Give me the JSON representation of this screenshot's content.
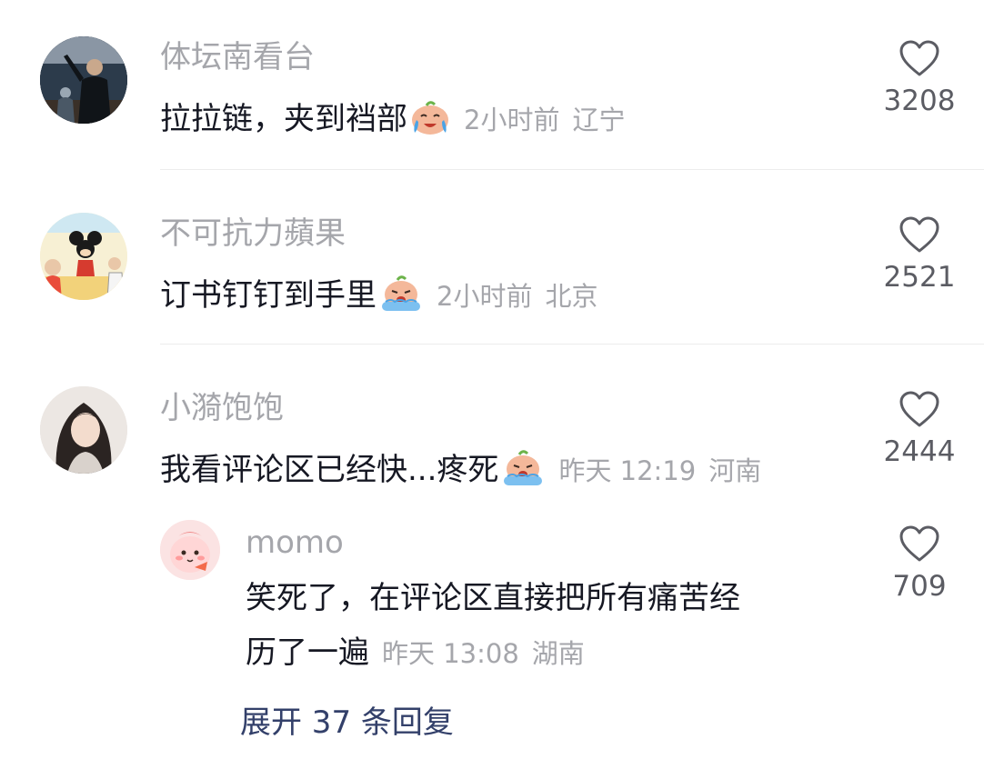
{
  "comments": [
    {
      "username": "体坛南看台",
      "text": "拉拉链，夹到裆部",
      "emoji": "crying-face-emoji",
      "time": "2小时前",
      "location": "辽宁",
      "likes": "3208",
      "avatar": "sports-photo-avatar"
    },
    {
      "username": "不可抗力蘋果",
      "text": "订书钉钉到手里",
      "emoji": "sobbing-face-emoji",
      "time": "2小时前",
      "location": "北京",
      "likes": "2521",
      "avatar": "cartoon-mouse-avatar"
    },
    {
      "username": "小漪饱饱",
      "text": "我看评论区已经快...疼死",
      "emoji": "sobbing-face-emoji",
      "time": "昨天 12:19",
      "location": "河南",
      "likes": "2444",
      "avatar": "portrait-avatar"
    }
  ],
  "reply": {
    "username": "momo",
    "text_line1": "笑死了，在评论区直接把所有痛苦经",
    "text_line2": "历了一遍",
    "time": "昨天 13:08",
    "location": "湖南",
    "likes": "709",
    "avatar": "pink-cartoon-avatar"
  },
  "expand_replies": "展开 37 条回复",
  "colors": {
    "username": "#a5a6ab",
    "text": "#161823",
    "meta": "#a5a6ab",
    "expand_link": "#33406a",
    "heart_stroke": "#5b5c63"
  }
}
